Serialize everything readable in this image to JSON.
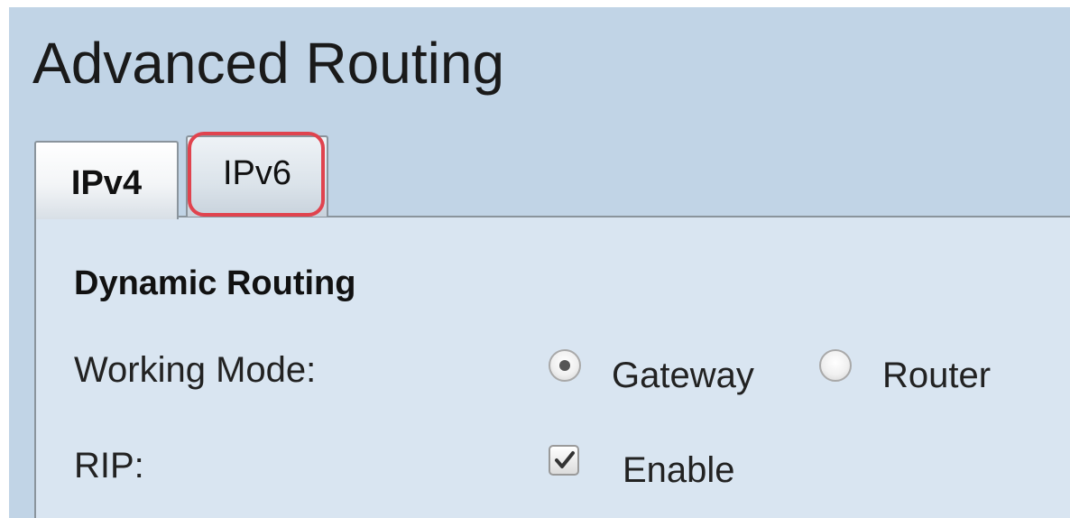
{
  "page": {
    "title": "Advanced Routing"
  },
  "tabs": {
    "ipv4": {
      "label": "IPv4",
      "active": true
    },
    "ipv6": {
      "label": "IPv6",
      "active": false,
      "highlighted": true
    }
  },
  "section": {
    "title": "Dynamic Routing"
  },
  "working_mode": {
    "label": "Working Mode:",
    "options": [
      "Gateway",
      "Router"
    ],
    "selected": "Gateway"
  },
  "rip": {
    "label": "RIP:",
    "checkbox_label": "Enable",
    "checked": true
  },
  "colors": {
    "header_bg": "#c1d4e6",
    "panel_bg": "#d9e5f1",
    "highlight": "#e0434e"
  }
}
